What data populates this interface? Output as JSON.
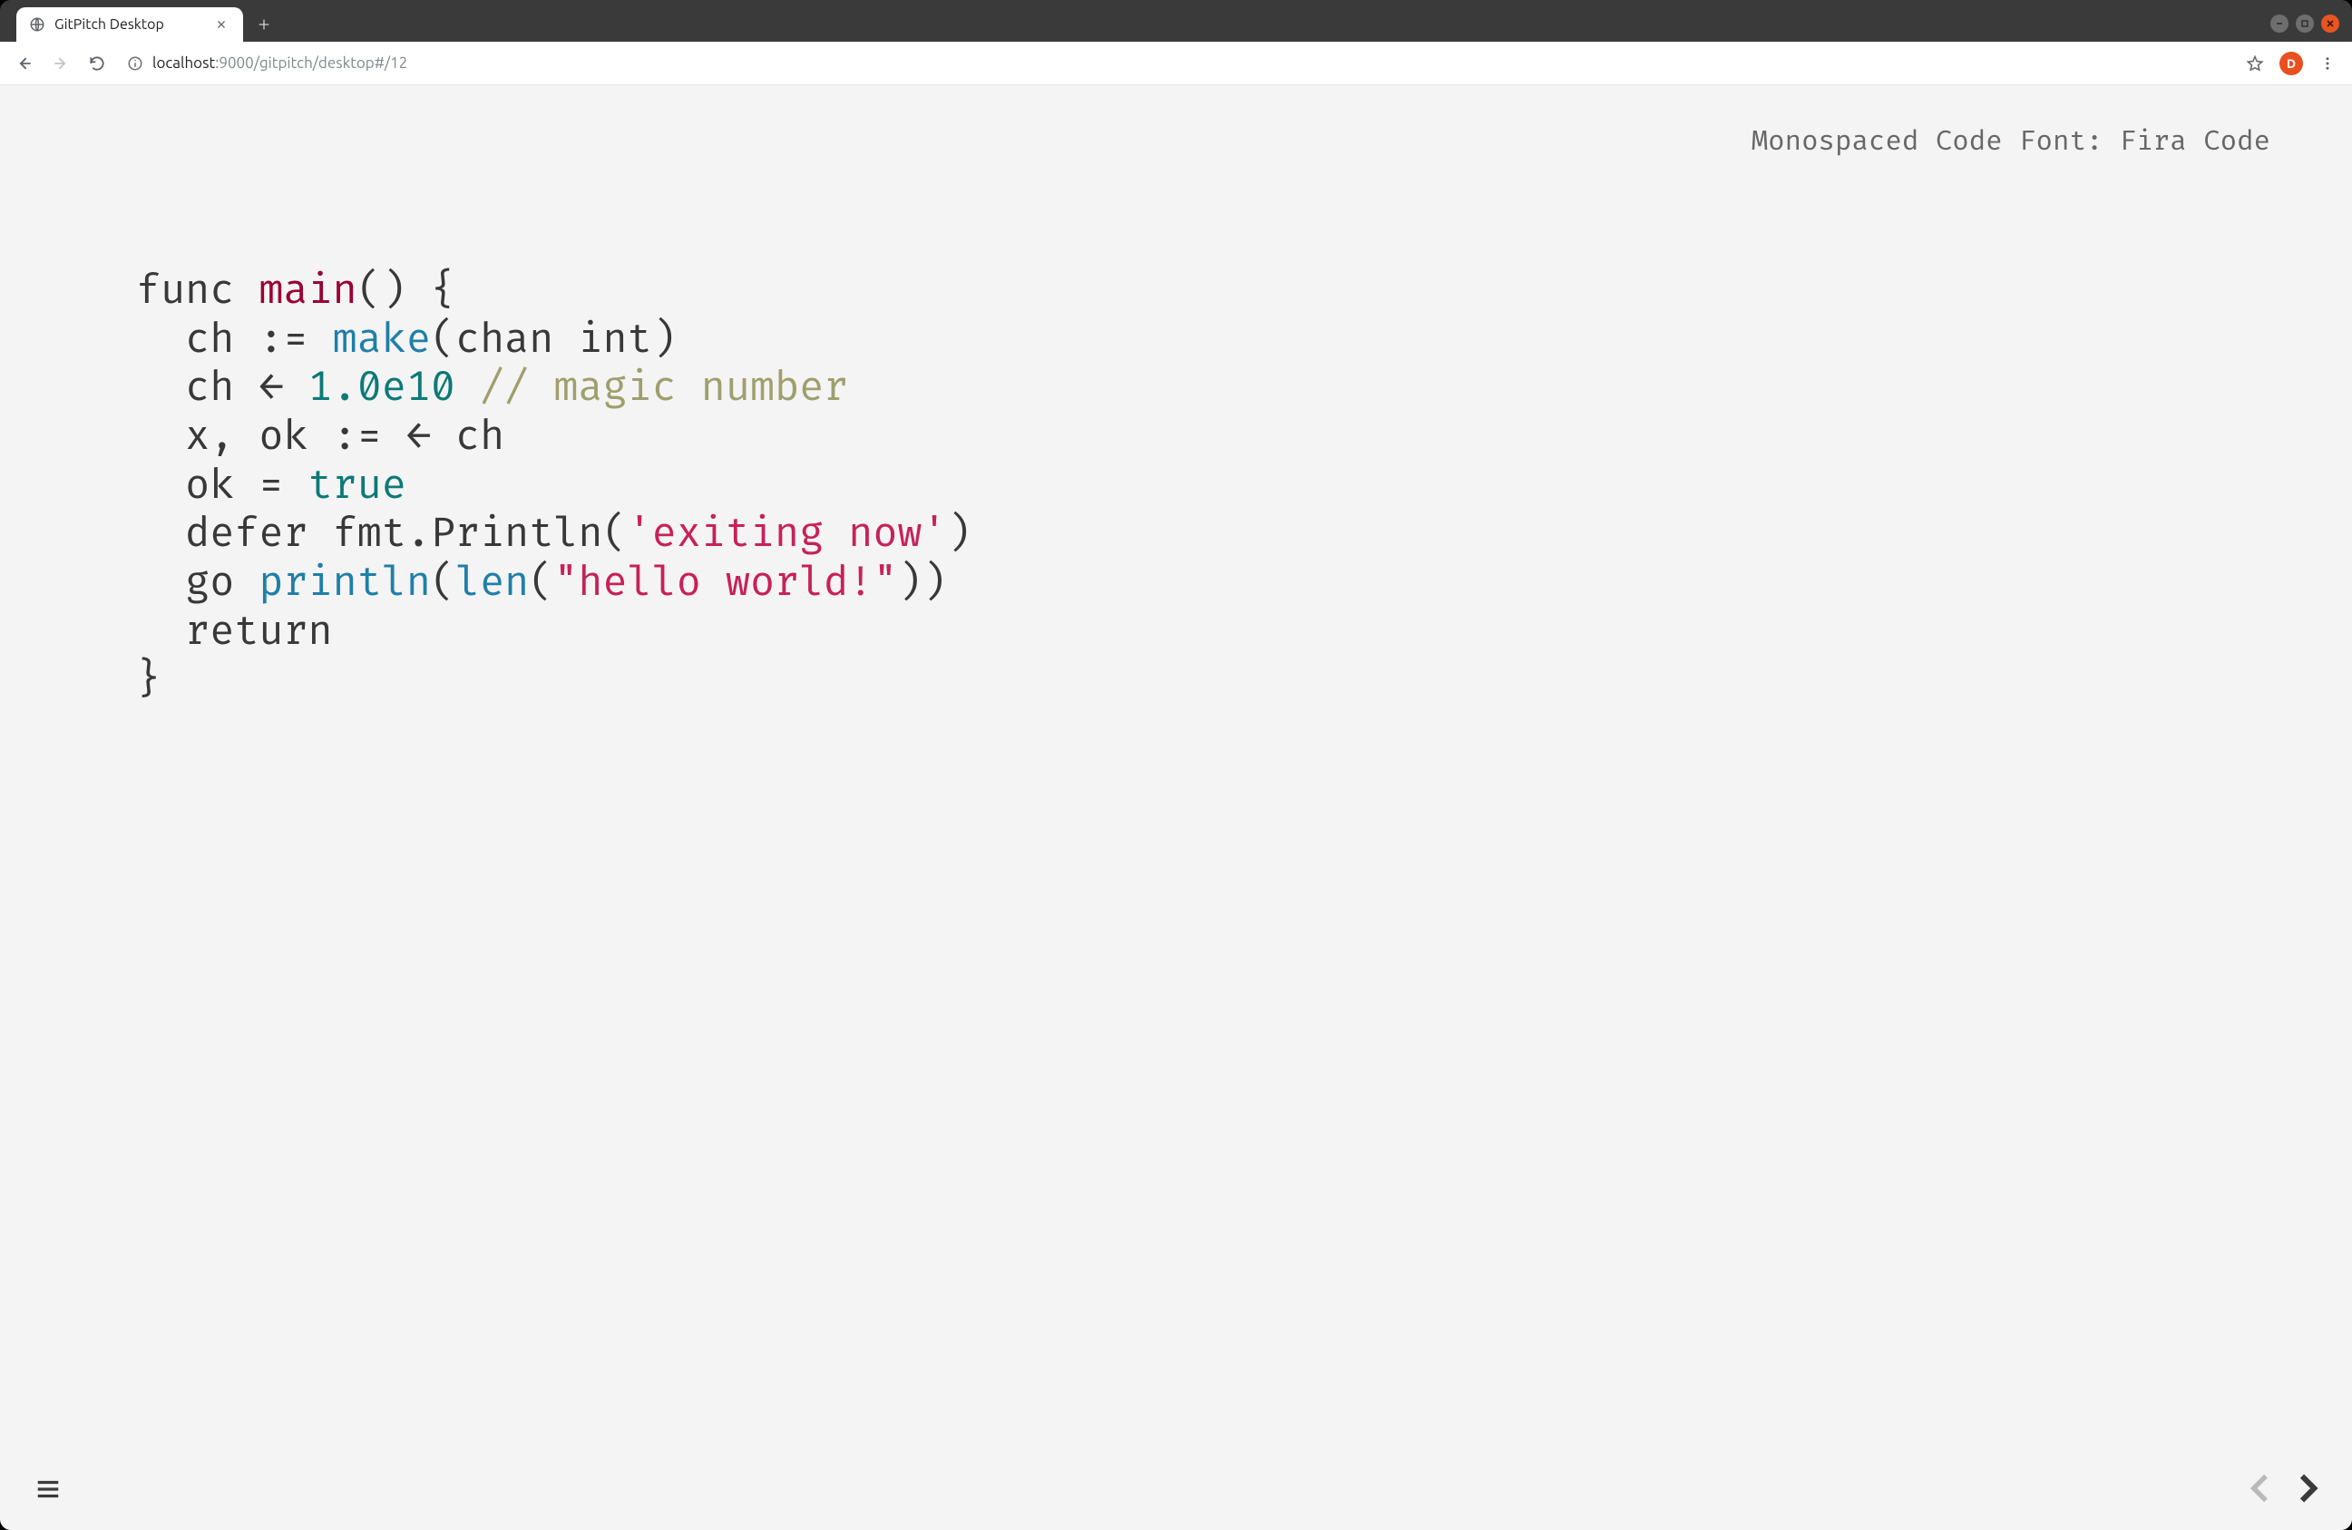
{
  "browser": {
    "tab_title": "GitPitch Desktop",
    "url_host": "localhost",
    "url_port_path": ":9000/gitpitch/desktop#/12",
    "avatar_initial": "D"
  },
  "slide": {
    "heading": "Monospaced Code Font: Fira Code"
  },
  "code": {
    "l1_func": "func ",
    "l1_main": "main",
    "l1_rest": "() {",
    "l2_pre": "  ch := ",
    "l2_make": "make",
    "l2_post": "(chan int)",
    "l3_pre": "  ch ← ",
    "l3_num": "1.0e10",
    "l3_sp": " ",
    "l3_cmt": "// magic number",
    "l4": "  x, ok := ← ch",
    "l5_pre": "  ok = ",
    "l5_true": "true",
    "l6_pre": "  defer fmt.Println(",
    "l6_str": "'exiting now'",
    "l6_post": ")",
    "l7_pre": "  go ",
    "l7_println": "println",
    "l7_open": "(",
    "l7_len": "len",
    "l7_open2": "(",
    "l7_str": "\"hello world!\"",
    "l7_close": "))",
    "l8": "  return",
    "l9": "}"
  }
}
